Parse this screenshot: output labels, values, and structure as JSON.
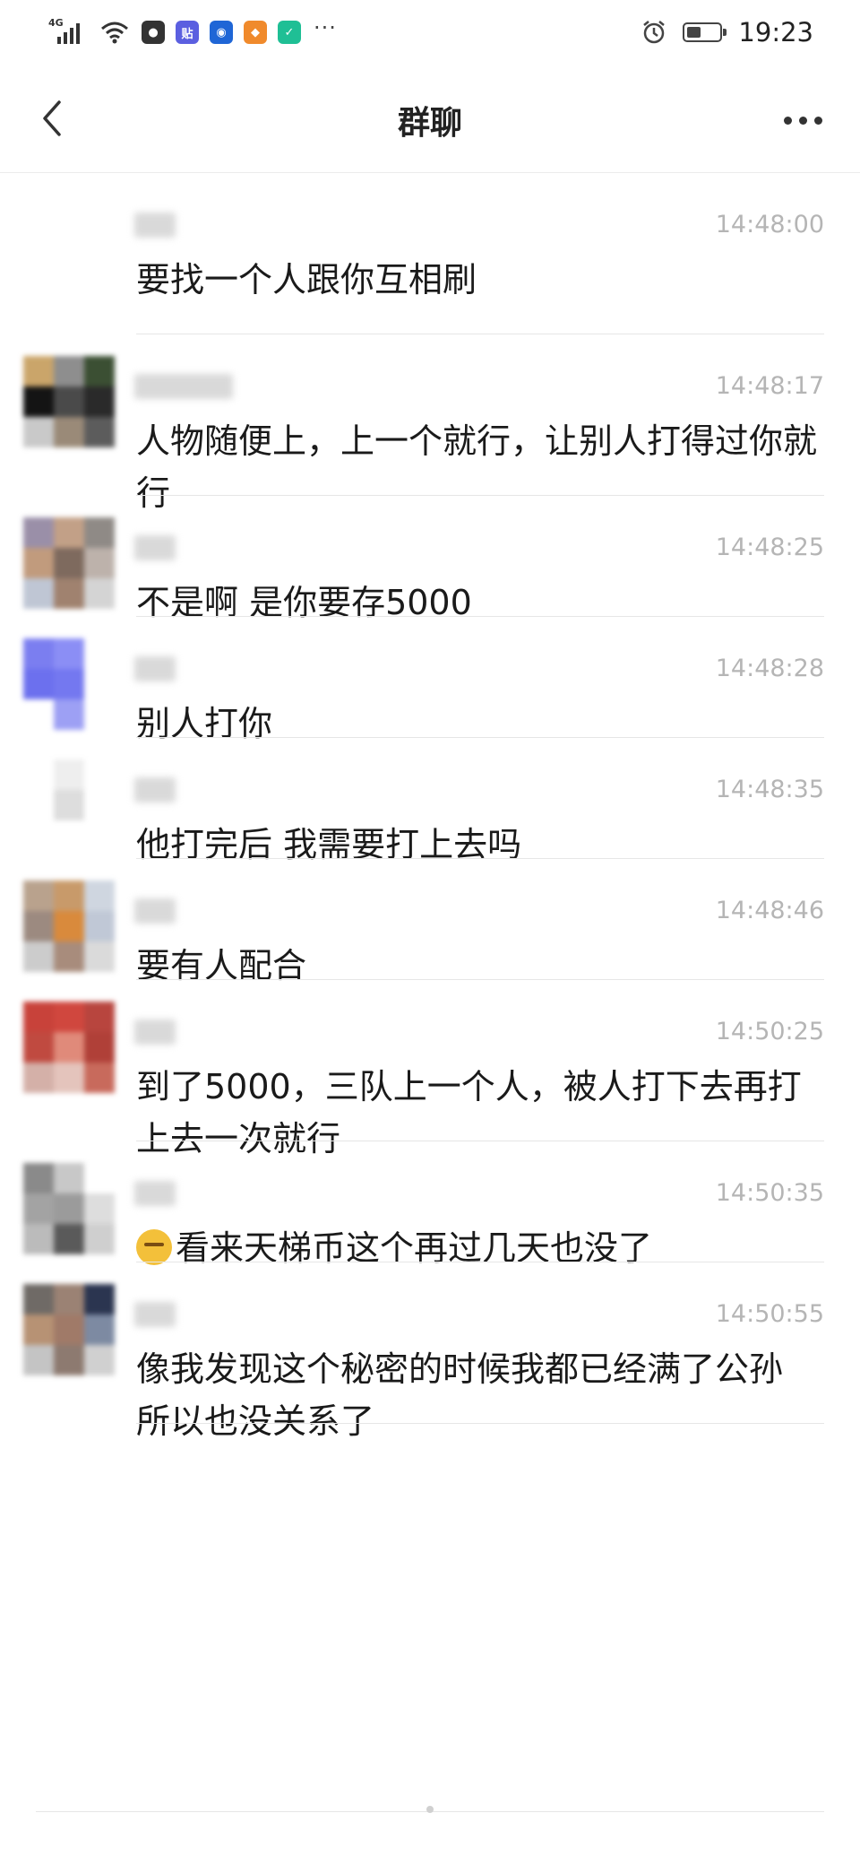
{
  "status_bar": {
    "network": "4G",
    "time": "19:23",
    "battery_level": 0.45,
    "app_icons": [
      {
        "name": "qq-icon",
        "color": "#333333",
        "glyph": "●"
      },
      {
        "name": "tieba-icon",
        "color": "#5b5fe0",
        "glyph": "贴"
      },
      {
        "name": "bulb-app-icon",
        "color": "#1f66d6",
        "glyph": "◉"
      },
      {
        "name": "orange-app-icon",
        "color": "#f08a2c",
        "glyph": "◆"
      },
      {
        "name": "green-app-icon",
        "color": "#1fbf95",
        "glyph": "✓"
      }
    ],
    "overflow": "···"
  },
  "header": {
    "title": "群聊"
  },
  "messages": [
    {
      "time": "14:48:00",
      "text": "要找一个人跟你互相刷",
      "avatar": "none"
    },
    {
      "time": "14:48:17",
      "text": "人物随便上，上一个就行，让别人打得过你就行",
      "avatar": "dark"
    },
    {
      "time": "14:48:25",
      "text": "不是啊 是你要存5000",
      "avatar": "warm"
    },
    {
      "time": "14:48:28",
      "text": "别人打你",
      "avatar": "purple"
    },
    {
      "time": "14:48:35",
      "text": "他打完后 我需要打上去吗",
      "avatar": "faint"
    },
    {
      "time": "14:48:46",
      "text": "要有人配合",
      "avatar": "orange"
    },
    {
      "time": "14:50:25",
      "text": "到了5000，三队上一个人，被人打下去再打上去一次就行",
      "avatar": "red"
    },
    {
      "time": "14:50:35",
      "text": "看来天梯币这个再过几天也没了",
      "avatar": "gray",
      "emoji": "face-icon"
    },
    {
      "time": "14:50:55",
      "text": "像我发现这个秘密的时候我都已经满了公孙 所以也没关系了",
      "avatar": "mixed"
    }
  ]
}
